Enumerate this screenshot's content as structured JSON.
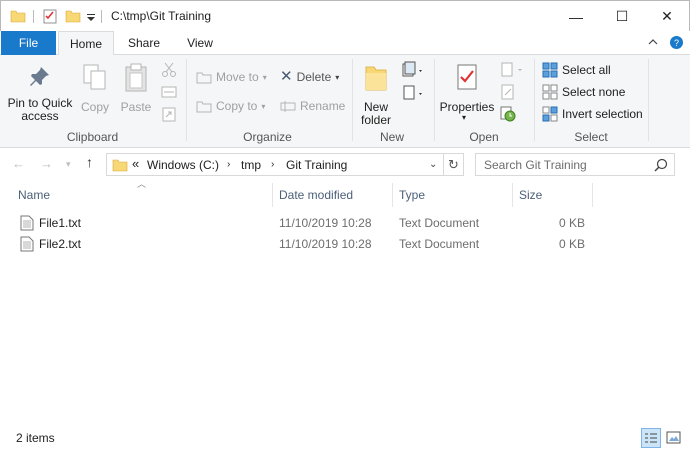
{
  "window": {
    "title": "C:\\tmp\\Git Training",
    "minimize": "—",
    "maximize": "☐",
    "close": "✕"
  },
  "tabs": {
    "file": "File",
    "home": "Home",
    "share": "Share",
    "view": "View"
  },
  "ribbon": {
    "clipboard": {
      "pin": "Pin to Quick access",
      "copy": "Copy",
      "paste": "Paste",
      "label": "Clipboard"
    },
    "organize": {
      "move_to": "Move to",
      "copy_to": "Copy to",
      "delete": "Delete",
      "rename": "Rename",
      "label": "Organize"
    },
    "new": {
      "new_folder": "New folder",
      "label": "New"
    },
    "open": {
      "properties": "Properties",
      "label": "Open"
    },
    "select": {
      "select_all": "Select all",
      "select_none": "Select none",
      "invert": "Invert selection",
      "label": "Select"
    }
  },
  "address": {
    "overflow": "«",
    "crumbs": [
      "Windows (C:)",
      "tmp",
      "Git Training"
    ],
    "search_placeholder": "Search Git Training"
  },
  "columns": {
    "name": "Name",
    "date": "Date modified",
    "type": "Type",
    "size": "Size"
  },
  "files": [
    {
      "name": "File1.txt",
      "date": "11/10/2019 10:28",
      "type": "Text Document",
      "size": "0 KB"
    },
    {
      "name": "File2.txt",
      "date": "11/10/2019 10:28",
      "type": "Text Document",
      "size": "0 KB"
    }
  ],
  "status": {
    "items": "2 items"
  },
  "colors": {
    "accent": "#1979ca",
    "folder": "#f8d775",
    "header_text": "#4c607a"
  }
}
